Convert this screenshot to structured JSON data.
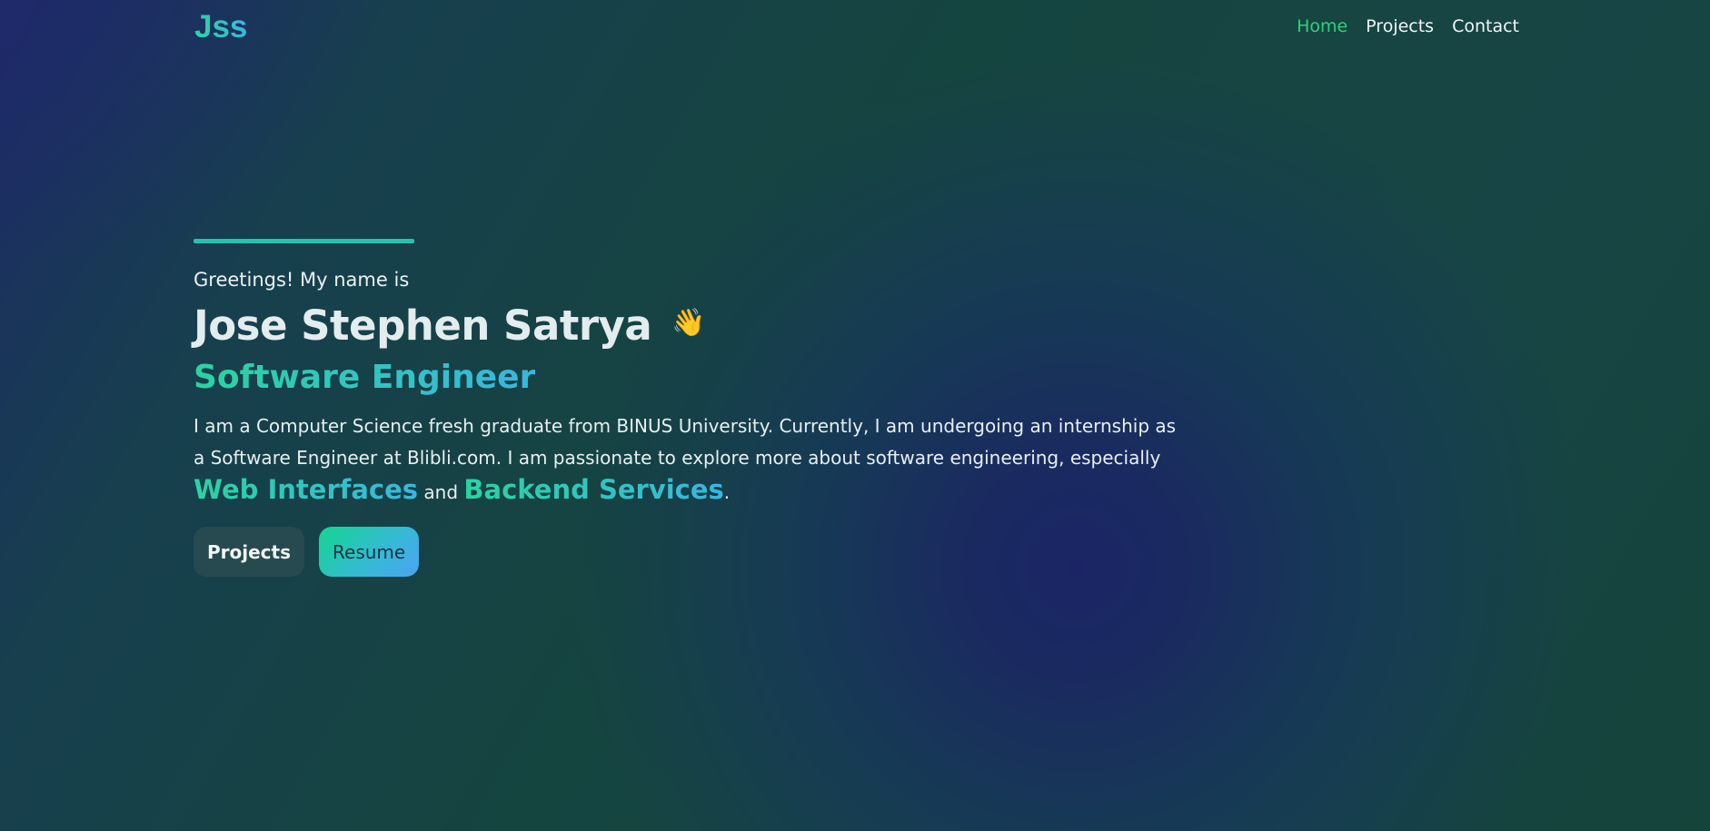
{
  "header": {
    "logo": "Jss",
    "nav": [
      {
        "label": "Home",
        "active": true
      },
      {
        "label": "Projects",
        "active": false
      },
      {
        "label": "Contact",
        "active": false
      }
    ]
  },
  "hero": {
    "greeting": "Greetings! My name is",
    "name": "Jose Stephen Satrya",
    "wave_emoji": "👋",
    "role": "Software Engineer",
    "bio_part1": "I am a Computer Science fresh graduate from BINUS University. Currently, I am undergoing an internship as a Software Engineer at Blibli.com. I am passionate to explore more about software engineering, especially",
    "highlight1": "Web Interfaces",
    "bio_and": "and",
    "highlight2": "Backend Services",
    "bio_end": "."
  },
  "buttons": {
    "projects": "Projects",
    "resume": "Resume"
  },
  "colors": {
    "accent_green": "#2bd37a",
    "gradient_start": "#2bd3a0",
    "gradient_end": "#3ab6df",
    "button_dark": "#264a4f"
  }
}
